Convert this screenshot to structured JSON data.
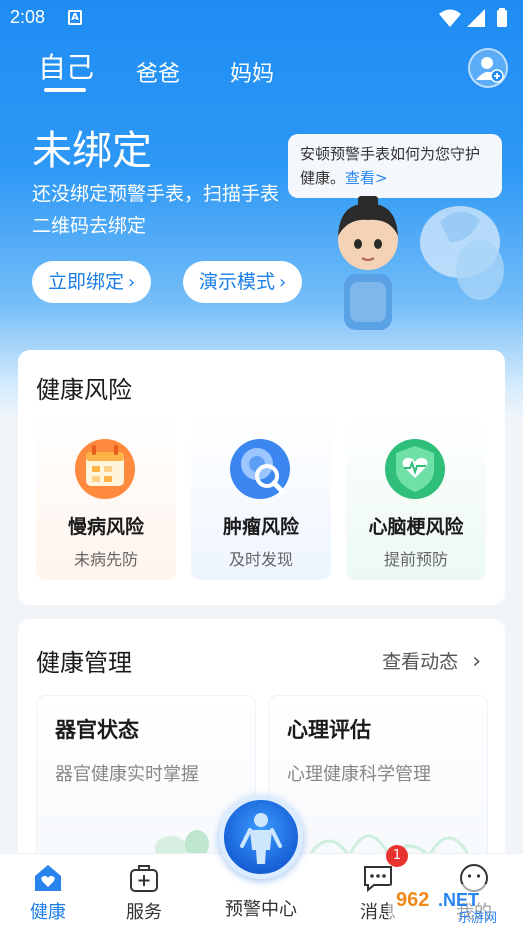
{
  "status_bar": {
    "time": "2:08",
    "notif_letter": "A"
  },
  "tabs": [
    {
      "label": "自己",
      "active": true
    },
    {
      "label": "爸爸",
      "active": false
    },
    {
      "label": "妈妈",
      "active": false
    }
  ],
  "hero": {
    "title": "未绑定",
    "description": "还没绑定预警手表，扫描手表二维码去绑定",
    "bind_button": "立即绑定",
    "demo_button": "演示模式",
    "bubble_text": "安顿预警手表如何为您守护健康。",
    "bubble_link": "查看>"
  },
  "health_risk": {
    "title": "健康风险",
    "items": [
      {
        "name": "慢病风险",
        "sub": "未病先防",
        "icon": "calendar-icon"
      },
      {
        "name": "肿瘤风险",
        "sub": "及时发现",
        "icon": "cell-search-icon"
      },
      {
        "name": "心脑梗风险",
        "sub": "提前预防",
        "icon": "heart-shield-icon"
      }
    ]
  },
  "health_mgmt": {
    "title": "健康管理",
    "link": "查看动态",
    "items": [
      {
        "name": "器官状态",
        "sub": "器官健康实时掌握"
      },
      {
        "name": "心理评估",
        "sub": "心理健康科学管理"
      }
    ]
  },
  "bottom_nav": {
    "items": [
      {
        "label": "健康",
        "icon": "home-heart-icon",
        "active": true
      },
      {
        "label": "服务",
        "icon": "medical-kit-icon",
        "active": false
      },
      {
        "label": "消息",
        "icon": "message-icon",
        "active": false
      },
      {
        "label": "我的",
        "icon": "profile-icon",
        "active": false
      }
    ],
    "center_label": "预警中心",
    "message_badge": "1"
  },
  "watermark": "962.NET 乐游网",
  "colors": {
    "primary": "#1f8cf3",
    "accent_text": "#1c7fe6",
    "badge": "#e8322e"
  }
}
